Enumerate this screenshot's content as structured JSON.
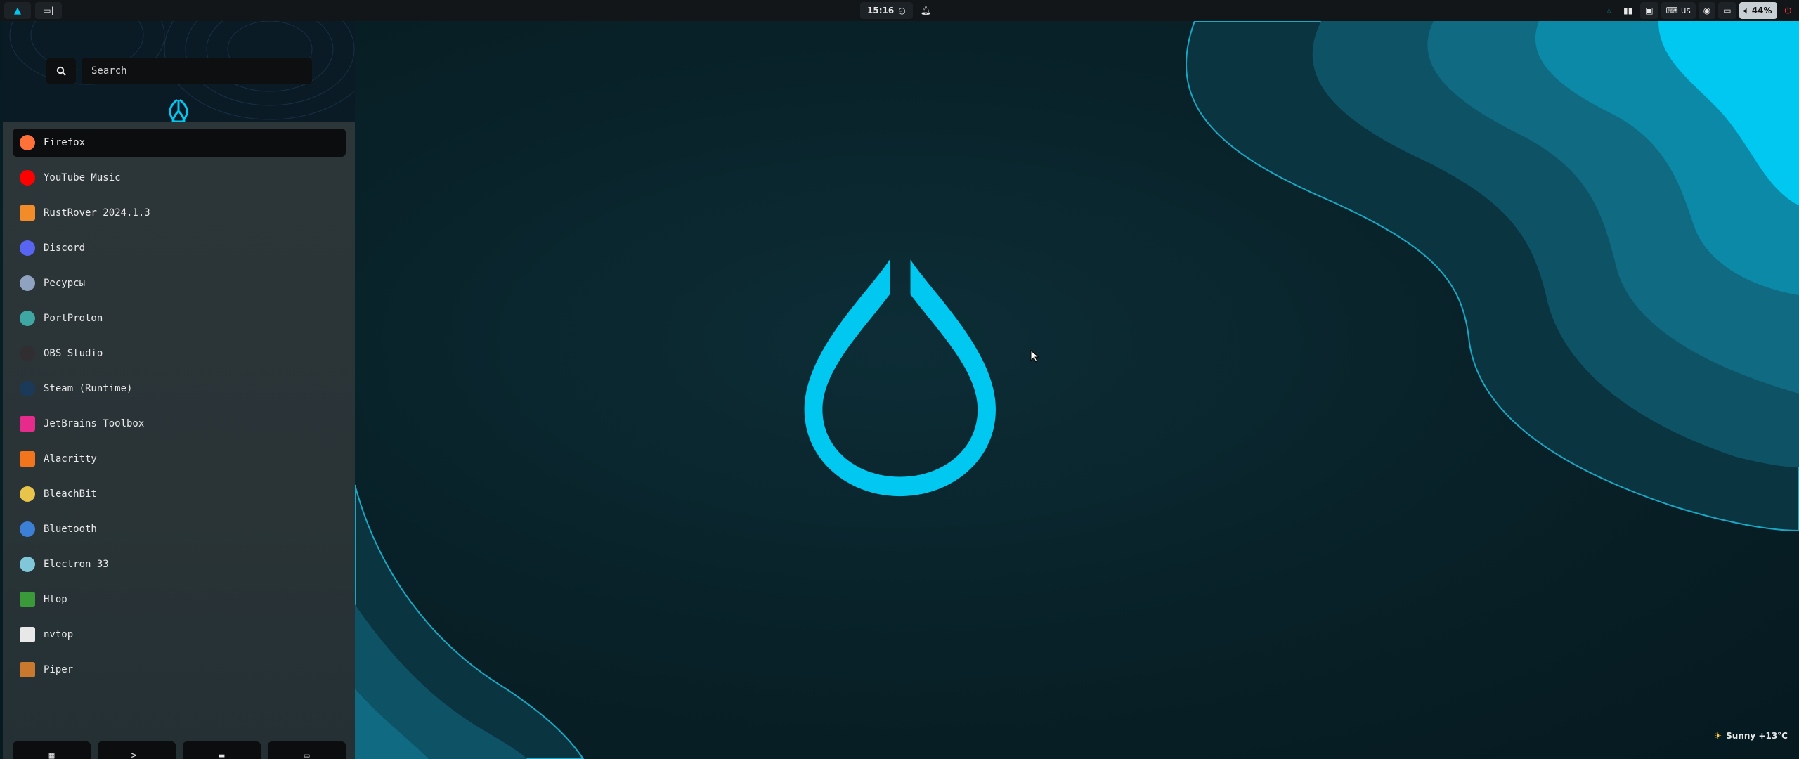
{
  "topbar": {
    "clock": "15:16",
    "keyboard_layout": "us",
    "volume": "44%"
  },
  "search": {
    "placeholder": "Search"
  },
  "apps": [
    {
      "label": "Firefox",
      "icon": "firefox-icon",
      "color": "#ff7139"
    },
    {
      "label": "YouTube Music",
      "icon": "youtube-music-icon",
      "color": "#ff0000"
    },
    {
      "label": "RustRover 2024.1.3",
      "icon": "rustrover-icon",
      "color": "#f28c28"
    },
    {
      "label": "Discord",
      "icon": "discord-icon",
      "color": "#5865f2"
    },
    {
      "label": "Ресурсы",
      "icon": "resources-icon",
      "color": "#8fa3c0"
    },
    {
      "label": "PortProton",
      "icon": "portproton-icon",
      "color": "#3fa7a3"
    },
    {
      "label": "OBS Studio",
      "icon": "obs-icon",
      "color": "#302e31"
    },
    {
      "label": "Steam (Runtime)",
      "icon": "steam-icon",
      "color": "#1b3a5a"
    },
    {
      "label": "JetBrains Toolbox",
      "icon": "jetbrains-toolbox-icon",
      "color": "#e52c8c"
    },
    {
      "label": "Alacritty",
      "icon": "alacritty-icon",
      "color": "#f2751e"
    },
    {
      "label": "BleachBit",
      "icon": "bleachbit-icon",
      "color": "#e8c44a"
    },
    {
      "label": "Bluetooth",
      "icon": "bluetooth-icon",
      "color": "#3b7fd6"
    },
    {
      "label": "Electron 33",
      "icon": "electron-icon",
      "color": "#7fc7d9"
    },
    {
      "label": "Htop",
      "icon": "htop-icon",
      "color": "#3a9a3a"
    },
    {
      "label": "nvtop",
      "icon": "nvtop-icon",
      "color": "#e8e8e8"
    },
    {
      "label": "Piper",
      "icon": "piper-icon",
      "color": "#c8792e"
    }
  ],
  "dock": [
    {
      "icon": "apps-grid-icon",
      "glyph": "▦"
    },
    {
      "icon": "terminal-icon",
      "glyph": ">_"
    },
    {
      "icon": "folder-icon",
      "glyph": "▬"
    },
    {
      "icon": "window-icon",
      "glyph": "▭"
    }
  ],
  "weather": {
    "text": "Sunny +13°C"
  },
  "colors": {
    "accent": "#00c8f0"
  }
}
